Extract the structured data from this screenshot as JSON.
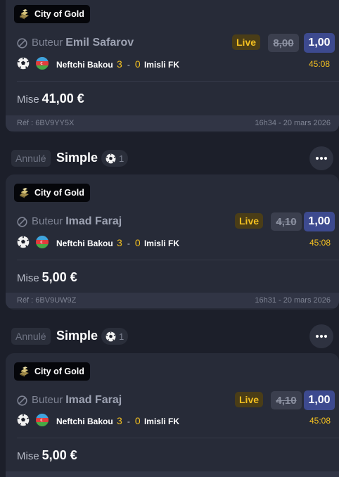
{
  "bets": [
    {
      "status": "",
      "bet_type": "",
      "count": "",
      "badge": "City of Gold",
      "selection_kind": "Buteur",
      "player": "Emil Safarov",
      "live": "Live",
      "odd_old": "8,00",
      "odd_new": "1,00",
      "home_team": "Neftchi Bakou",
      "home_score": "3",
      "separator": "-",
      "away_score": "0",
      "away_team": "Imisli FK",
      "match_time": "45:08",
      "stake_label": "Mise",
      "stake_amount": "41,00 €",
      "ref": "Réf : 6BV9YY5X",
      "placed_at": "16h34 - 20 mars 2026"
    },
    {
      "status": "Annulé",
      "bet_type": "Simple",
      "count": "1",
      "badge": "City of Gold",
      "selection_kind": "Buteur",
      "player": "Imad Faraj",
      "live": "Live",
      "odd_old": "4,10",
      "odd_new": "1,00",
      "home_team": "Neftchi Bakou",
      "home_score": "3",
      "separator": "-",
      "away_score": "0",
      "away_team": "Imisli FK",
      "match_time": "45:08",
      "stake_label": "Mise",
      "stake_amount": "5,00 €",
      "ref": "Réf : 6BV9UW9Z",
      "placed_at": "16h31 - 20 mars 2026"
    },
    {
      "status": "Annulé",
      "bet_type": "Simple",
      "count": "1",
      "badge": "City of Gold",
      "selection_kind": "Buteur",
      "player": "Imad Faraj",
      "live": "Live",
      "odd_old": "4,10",
      "odd_new": "1,00",
      "home_team": "Neftchi Bakou",
      "home_score": "3",
      "separator": "-",
      "away_score": "0",
      "away_team": "Imisli FK",
      "match_time": "45:08",
      "stake_label": "Mise",
      "stake_amount": "5,00 €",
      "ref": "",
      "placed_at": ""
    }
  ],
  "icons": {
    "sport": "soccer-ball-icon",
    "flag": "azerbaijan-flag-icon",
    "promo": "gold-bars-icon",
    "selection_state": "cancelled-icon",
    "more": "more-dots-icon"
  },
  "colors": {
    "live": "#f4c020",
    "odd_new_bg": "#3d4a8f",
    "background": "#1c1f2a",
    "card": "#272b38"
  }
}
